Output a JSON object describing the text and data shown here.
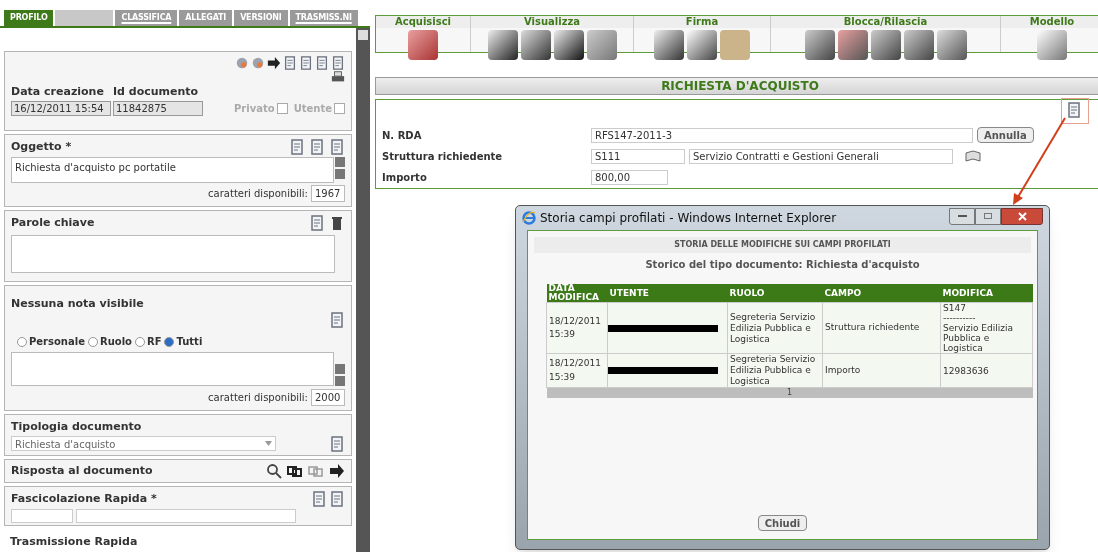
{
  "tabs": [
    {
      "label": "PROFILO",
      "selected": true,
      "underlined": false
    },
    {
      "kind": "blank",
      "selected": false
    },
    {
      "label": "CLASSIFICA",
      "selected": false,
      "underlined": true
    },
    {
      "label": "ALLEGATI",
      "selected": false,
      "underlined": false
    },
    {
      "label": "VERSIONI",
      "selected": false,
      "underlined": false
    },
    {
      "label": "TRASMISS.NI",
      "selected": false,
      "underlined": true
    }
  ],
  "header": {
    "created_label": "Data creazione",
    "id_label": "Id documento",
    "created_value": "16/12/2011 15:54",
    "id_value": "11842875",
    "checkboxes": [
      {
        "label": "Privato",
        "checked": false,
        "disabled": true
      },
      {
        "label": "Utente",
        "checked": false,
        "disabled": true
      }
    ]
  },
  "oggetto": {
    "label": "Oggetto *",
    "value": "Richiesta d'acquisto pc portatile",
    "chars_label": "caratteri disponibili:",
    "chars": "1967"
  },
  "parole_chiave": {
    "label": "Parole chiave"
  },
  "note": {
    "label": "Nessuna nota visibile",
    "radios": [
      {
        "label": "Personale",
        "selected": false
      },
      {
        "label": "Ruolo",
        "selected": false
      },
      {
        "label": "RF",
        "selected": false
      },
      {
        "label": "Tutti",
        "selected": true
      }
    ],
    "chars_label": "caratteri disponibili:",
    "chars": "2000"
  },
  "tipologia": {
    "label": "Tipologia documento",
    "value": "Richiesta d'acquisto"
  },
  "risposta": {
    "label": "Risposta al documento"
  },
  "fascicolazione": {
    "label": "Fascicolazione Rapida *"
  },
  "trasmissione": {
    "label": "Trasmissione Rapida"
  },
  "toolbar": [
    {
      "label": "Acquisisci"
    },
    {
      "label": "Visualizza"
    },
    {
      "label": "Firma"
    },
    {
      "label": "Blocca/Rilascia"
    },
    {
      "label": "Modello"
    }
  ],
  "doc_title": "RICHIESTA D'ACQUISTO",
  "form": {
    "rows": [
      {
        "label": "N. RDA",
        "kind": "text_button",
        "value": "RFS147-2011-3",
        "button": "Annulla"
      },
      {
        "label": "Struttura richiedente",
        "kind": "code_desc",
        "code": "S111",
        "value": "Servizio Contratti e Gestioni Generali"
      },
      {
        "label": "Importo",
        "kind": "short",
        "value": "800,00"
      }
    ]
  },
  "popup": {
    "title": "Storia campi profilati - Windows Internet Explorer",
    "heading": "STORIA DELLE MODIFICHE SUI CAMPI PROFILATI",
    "subtitle": "Storico del tipo documento: Richiesta d'acquisto",
    "columns": [
      "DATA MODIFICA",
      "UTENTE",
      "RUOLO",
      "CAMPO",
      "MODIFICA"
    ],
    "rows": [
      {
        "date": "18/12/2011 15:39",
        "user_redacted": true,
        "role": "Segreteria Servizio Edilizia Pubblica e Logistica",
        "field": "Struttura richiedente",
        "change": [
          "S147",
          "----------",
          "Servizio Edilizia Pubblica e Logistica"
        ]
      },
      {
        "date": "18/12/2011 15:39",
        "user_redacted": true,
        "role": "Segreteria Servizio Edilizia Pubblica e Logistica",
        "field": "Importo",
        "change": [
          "12983636"
        ]
      }
    ],
    "page": "1",
    "close_button": "Chiudi"
  }
}
